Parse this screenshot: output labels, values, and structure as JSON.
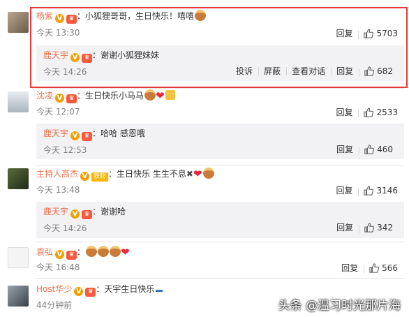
{
  "comments": [
    {
      "name": "杨紫",
      "text": "：小狐狸哥哥，生日快乐！嘻嘻",
      "time": "今天 13:30",
      "reply_label": "回复",
      "likes": "5703",
      "reply": {
        "name": "鹿天宇",
        "text": "：谢谢小狐狸妹妹",
        "time": "今天 14:26",
        "actions": [
          "投诉",
          "屏蔽",
          "查看对话",
          "回复"
        ],
        "likes": "682"
      }
    },
    {
      "name": "沈凌",
      "text": "：生日快乐小马马",
      "time": "今天 12:07",
      "reply_label": "回复",
      "likes": "2533",
      "reply": {
        "name": "鹿天宇",
        "text": "：哈哈 感恩哦",
        "time": "今天 12:53",
        "actions": [
          "回复"
        ],
        "likes": "460"
      }
    },
    {
      "name": "主持人高杰",
      "badge": "铁粉",
      "text": "：生日快乐 生生不息",
      "time": "今天 13:48",
      "reply_label": "回复",
      "likes": "3146",
      "reply": {
        "name": "鹿天宇",
        "text": "：谢谢哈",
        "time": "今天 14:26",
        "actions": [
          "回复"
        ],
        "likes": "342"
      }
    },
    {
      "name": "袁弘",
      "text": "：",
      "time": "今天 16:48",
      "reply_label": "回复",
      "likes": "566"
    },
    {
      "name": "Host华少",
      "text": "：天宇生日快乐",
      "time": "44分钟前"
    }
  ],
  "watermark": "头条 @温习时光那片海",
  "icons": {
    "verified": "v-badge-icon",
    "vip": "vip-icon",
    "like": "thumb-up-icon"
  },
  "colors": {
    "name": "#eb7350",
    "highlight": "#e73a3a",
    "reply_bg": "#f2f2f5"
  }
}
